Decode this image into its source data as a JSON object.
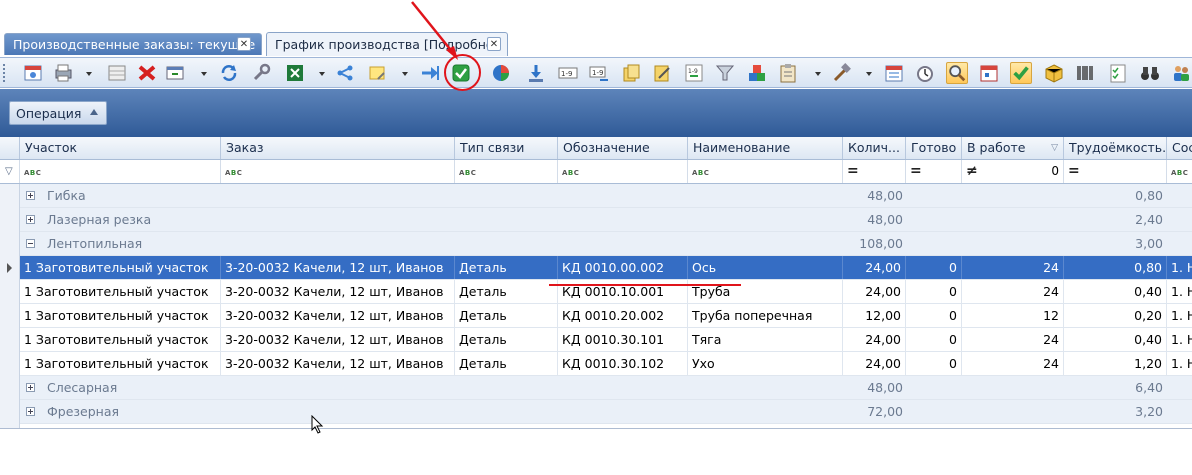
{
  "tabs": [
    {
      "label": "Производственные заказы: текущие",
      "active": false
    },
    {
      "label": "График производства [Подробно]",
      "active": true
    }
  ],
  "tab_close_glyph": "✕",
  "toolbar": {
    "buttons": [
      "calendar-icon",
      "printer-icon",
      "print-dropdown-arrow",
      "table-icon",
      "delete-icon",
      "view-icon",
      "view-dropdown-arrow",
      "refresh-icon",
      "wrench-icon",
      "excel-icon",
      "excel-dropdown-arrow",
      "share-icon",
      "note-icon",
      "note-dropdown-arrow",
      "export-arrow-icon",
      "confirm-check-icon",
      "pie-chart-icon",
      "download-icon",
      "numbering-icon",
      "numbering-arrow-icon",
      "copy-icon",
      "edit-icon",
      "sort-icon",
      "filter-icon",
      "blocks-icon",
      "clipboard-icon",
      "clipboard-dropdown-arrow",
      "hammer-icon",
      "hammer-dropdown-arrow",
      "schedule-icon",
      "timer-icon",
      "search-icon",
      "calendar-red-icon",
      "check-icon",
      "package-icon",
      "barcode-icon",
      "checklist-icon",
      "binoculars-icon",
      "people-icon"
    ],
    "active_buttons": [
      "search-icon",
      "check-icon"
    ]
  },
  "group_panel": {
    "chip_label": "Операция"
  },
  "columns": [
    {
      "key": "uchastok",
      "label": "Участок"
    },
    {
      "key": "zakaz",
      "label": "Заказ"
    },
    {
      "key": "tip",
      "label": "Тип связи"
    },
    {
      "key": "oboz",
      "label": "Обозначение"
    },
    {
      "key": "naim",
      "label": "Наименование"
    },
    {
      "key": "kol",
      "label": "Колич..."
    },
    {
      "key": "gotovo",
      "label": "Готово"
    },
    {
      "key": "vrabote",
      "label": "В работе"
    },
    {
      "key": "trud",
      "label": "Трудоёмкость..."
    },
    {
      "key": "sos",
      "label": "Сос"
    }
  ],
  "filter_row": {
    "abc_glyph": "ABC",
    "eq_glyph": "=",
    "neq_glyph": "≠",
    "vrabote_value": "0"
  },
  "rows": [
    {
      "type": "group",
      "expanded": false,
      "label": "Гибка",
      "kol": "48,00",
      "trud": "0,80"
    },
    {
      "type": "group",
      "expanded": false,
      "label": "Лазерная резка",
      "kol": "48,00",
      "trud": "2,40"
    },
    {
      "type": "group",
      "expanded": true,
      "label": "Лентопильная",
      "kol": "108,00",
      "trud": "3,00"
    },
    {
      "type": "data",
      "selected": true,
      "uchastok": "1 Заготовительный участок",
      "zakaz": "3-20-0032 Качели, 12 шт, Иванов",
      "tip": "Деталь",
      "oboz": "КД 0010.00.002",
      "naim": "Ось",
      "kol": "24,00",
      "gotovo": "0",
      "vrabote": "24",
      "trud": "0,80",
      "sos": "1. Н"
    },
    {
      "type": "data",
      "selected": false,
      "uchastok": "1 Заготовительный участок",
      "zakaz": "3-20-0032 Качели, 12 шт, Иванов",
      "tip": "Деталь",
      "oboz": "КД 0010.10.001",
      "naim": "Труба",
      "kol": "24,00",
      "gotovo": "0",
      "vrabote": "24",
      "trud": "0,40",
      "sos": "1. Н"
    },
    {
      "type": "data",
      "selected": false,
      "uchastok": "1 Заготовительный участок",
      "zakaz": "3-20-0032 Качели, 12 шт, Иванов",
      "tip": "Деталь",
      "oboz": "КД 0010.20.002",
      "naim": "Труба поперечная",
      "kol": "12,00",
      "gotovo": "0",
      "vrabote": "12",
      "trud": "0,20",
      "sos": "1. Н"
    },
    {
      "type": "data",
      "selected": false,
      "uchastok": "1 Заготовительный участок",
      "zakaz": "3-20-0032 Качели, 12 шт, Иванов",
      "tip": "Деталь",
      "oboz": "КД 0010.30.101",
      "naim": "Тяга",
      "kol": "24,00",
      "gotovo": "0",
      "vrabote": "24",
      "trud": "0,40",
      "sos": "1. Н"
    },
    {
      "type": "data",
      "selected": false,
      "uchastok": "1 Заготовительный участок",
      "zakaz": "3-20-0032 Качели, 12 шт, Иванов",
      "tip": "Деталь",
      "oboz": "КД 0010.30.102",
      "naim": "Ухо",
      "kol": "24,00",
      "gotovo": "0",
      "vrabote": "24",
      "trud": "1,20",
      "sos": "1. Н"
    },
    {
      "type": "group",
      "expanded": false,
      "label": "Слесарная",
      "kol": "48,00",
      "trud": "6,40"
    },
    {
      "type": "group",
      "expanded": false,
      "label": "Фрезерная",
      "kol": "72,00",
      "trud": "3,20"
    }
  ],
  "colors": {
    "selection": "#356dc4",
    "annotation": "#e0141b",
    "group_text": "#6b7a90"
  }
}
